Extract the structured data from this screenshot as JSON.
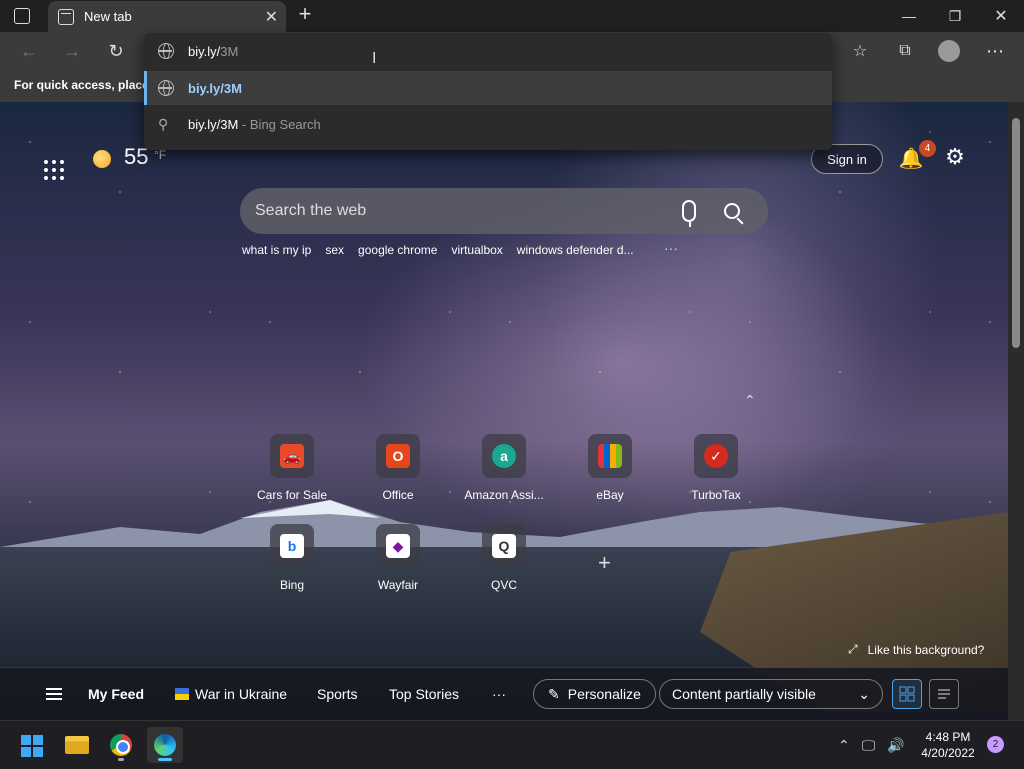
{
  "browser": {
    "tab_title": "New tab",
    "tab_close": "✕",
    "new_tab": "+",
    "address_typed": "biy.ly/",
    "address_autocomplete": "3M",
    "suggestions": [
      {
        "text": "biy.ly/3M",
        "type": "url"
      },
      {
        "text": "biy.ly/3M",
        "suffix": " - Bing Search",
        "type": "search"
      }
    ],
    "favbar_text": "For quick access, place y"
  },
  "newtab": {
    "weather": {
      "temp": "55",
      "unit": "°F"
    },
    "signin": "Sign in",
    "notif_count": "4",
    "search_placeholder": "Search the web",
    "trending": [
      "what is my ip",
      "sex",
      "google chrome",
      "virtualbox",
      "windows defender d..."
    ],
    "trending_more": "···",
    "quicklinks": [
      {
        "label": "Cars for Sale",
        "icon": "car-icon",
        "color": "#e84b2c",
        "glyph": "🚗"
      },
      {
        "label": "Office",
        "icon": "office-icon",
        "color": "#e5471b",
        "glyph": "O"
      },
      {
        "label": "Amazon Assi...",
        "icon": "amazon-assistant-icon",
        "color": "#1aa891",
        "glyph": "a"
      },
      {
        "label": "eBay",
        "icon": "ebay-icon",
        "color": "#d9263c",
        "glyph": "e"
      },
      {
        "label": "TurboTax",
        "icon": "turbotax-icon",
        "color": "#d52b1e",
        "glyph": "✓"
      },
      {
        "label": "Bing",
        "icon": "bing-icon",
        "color": "#ffffff",
        "glyph": "b"
      },
      {
        "label": "Wayfair",
        "icon": "wayfair-icon",
        "color": "#7b189f",
        "glyph": "◆"
      },
      {
        "label": "QVC",
        "icon": "qvc-icon",
        "color": "#ffffff",
        "glyph": "Q"
      }
    ],
    "add_tile": "+",
    "like_bg": "Like this background?",
    "feed": {
      "my_feed": "My Feed",
      "ukraine": "War in Ukraine",
      "sports": "Sports",
      "top_stories": "Top Stories",
      "more": "···",
      "personalize": "Personalize",
      "content_visibility": "Content partially visible"
    }
  },
  "taskbar": {
    "time": "4:48 PM",
    "date": "4/20/2022",
    "notifications": "2"
  }
}
